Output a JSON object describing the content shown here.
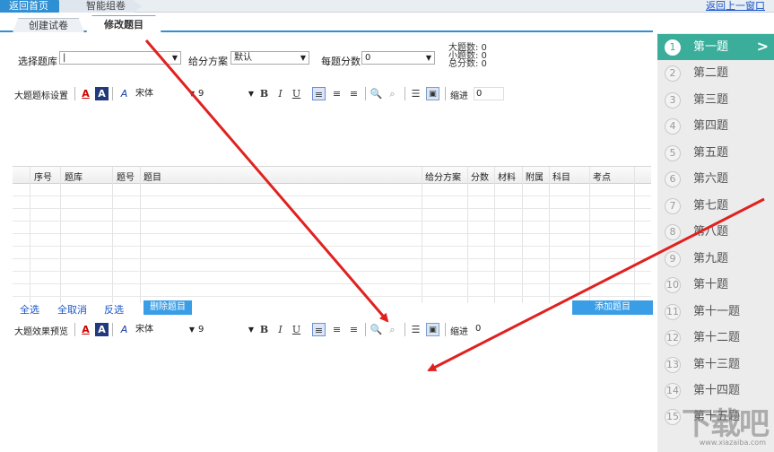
{
  "topbar": {
    "home_label": "返回首页",
    "crumb_label": "智能组卷",
    "back_link": "返回上一窗口"
  },
  "tabs": [
    {
      "label": "创建试卷"
    },
    {
      "label": "修改题目"
    }
  ],
  "filters": {
    "bank_label": "选择题库",
    "bank_value": "|",
    "scheme_label": "给分方案",
    "scheme_value": "默认",
    "score_label": "每题分数",
    "score_value": "0"
  },
  "stats": {
    "big_count": "大题数: 0",
    "small_count": "小题数: 0",
    "total_score": "总分数: 0"
  },
  "toolbar1": {
    "label": "大题题标设置",
    "font": "宋体",
    "size": "9",
    "bold": "B",
    "italic": "I",
    "underline": "U",
    "indent_label": "缩进",
    "indent_value": "0"
  },
  "grid": {
    "columns": [
      "序号",
      "题库",
      "题号",
      "题目",
      "给分方案",
      "分数",
      "材料",
      "附属",
      "科目",
      "考点"
    ]
  },
  "actions": {
    "select_all": "全选",
    "deselect_all": "全取消",
    "invert": "反选",
    "delete": "删除题目",
    "add": "添加题目"
  },
  "toolbar2": {
    "label": "大题效果预览",
    "font": "宋体",
    "size": "9",
    "bold": "B",
    "italic": "I",
    "underline": "U",
    "indent_label": "缩进",
    "indent_value": "0"
  },
  "questions": [
    {
      "num": "1",
      "label": "第一题"
    },
    {
      "num": "2",
      "label": "第二题"
    },
    {
      "num": "3",
      "label": "第三题"
    },
    {
      "num": "4",
      "label": "第四题"
    },
    {
      "num": "5",
      "label": "第五题"
    },
    {
      "num": "6",
      "label": "第六题"
    },
    {
      "num": "7",
      "label": "第七题"
    },
    {
      "num": "8",
      "label": "第八题"
    },
    {
      "num": "9",
      "label": "第九题"
    },
    {
      "num": "10",
      "label": "第十题"
    },
    {
      "num": "11",
      "label": "第十一题"
    },
    {
      "num": "12",
      "label": "第十二题"
    },
    {
      "num": "13",
      "label": "第十三题"
    },
    {
      "num": "14",
      "label": "第十四题"
    },
    {
      "num": "15",
      "label": "第十五题"
    }
  ],
  "colors": {
    "accent": "#2f8fd3",
    "active_item": "#3aae9b",
    "arrow": "#e0211f"
  },
  "watermark": {
    "text": "下载吧",
    "url": "www.xiazaiba.com"
  }
}
